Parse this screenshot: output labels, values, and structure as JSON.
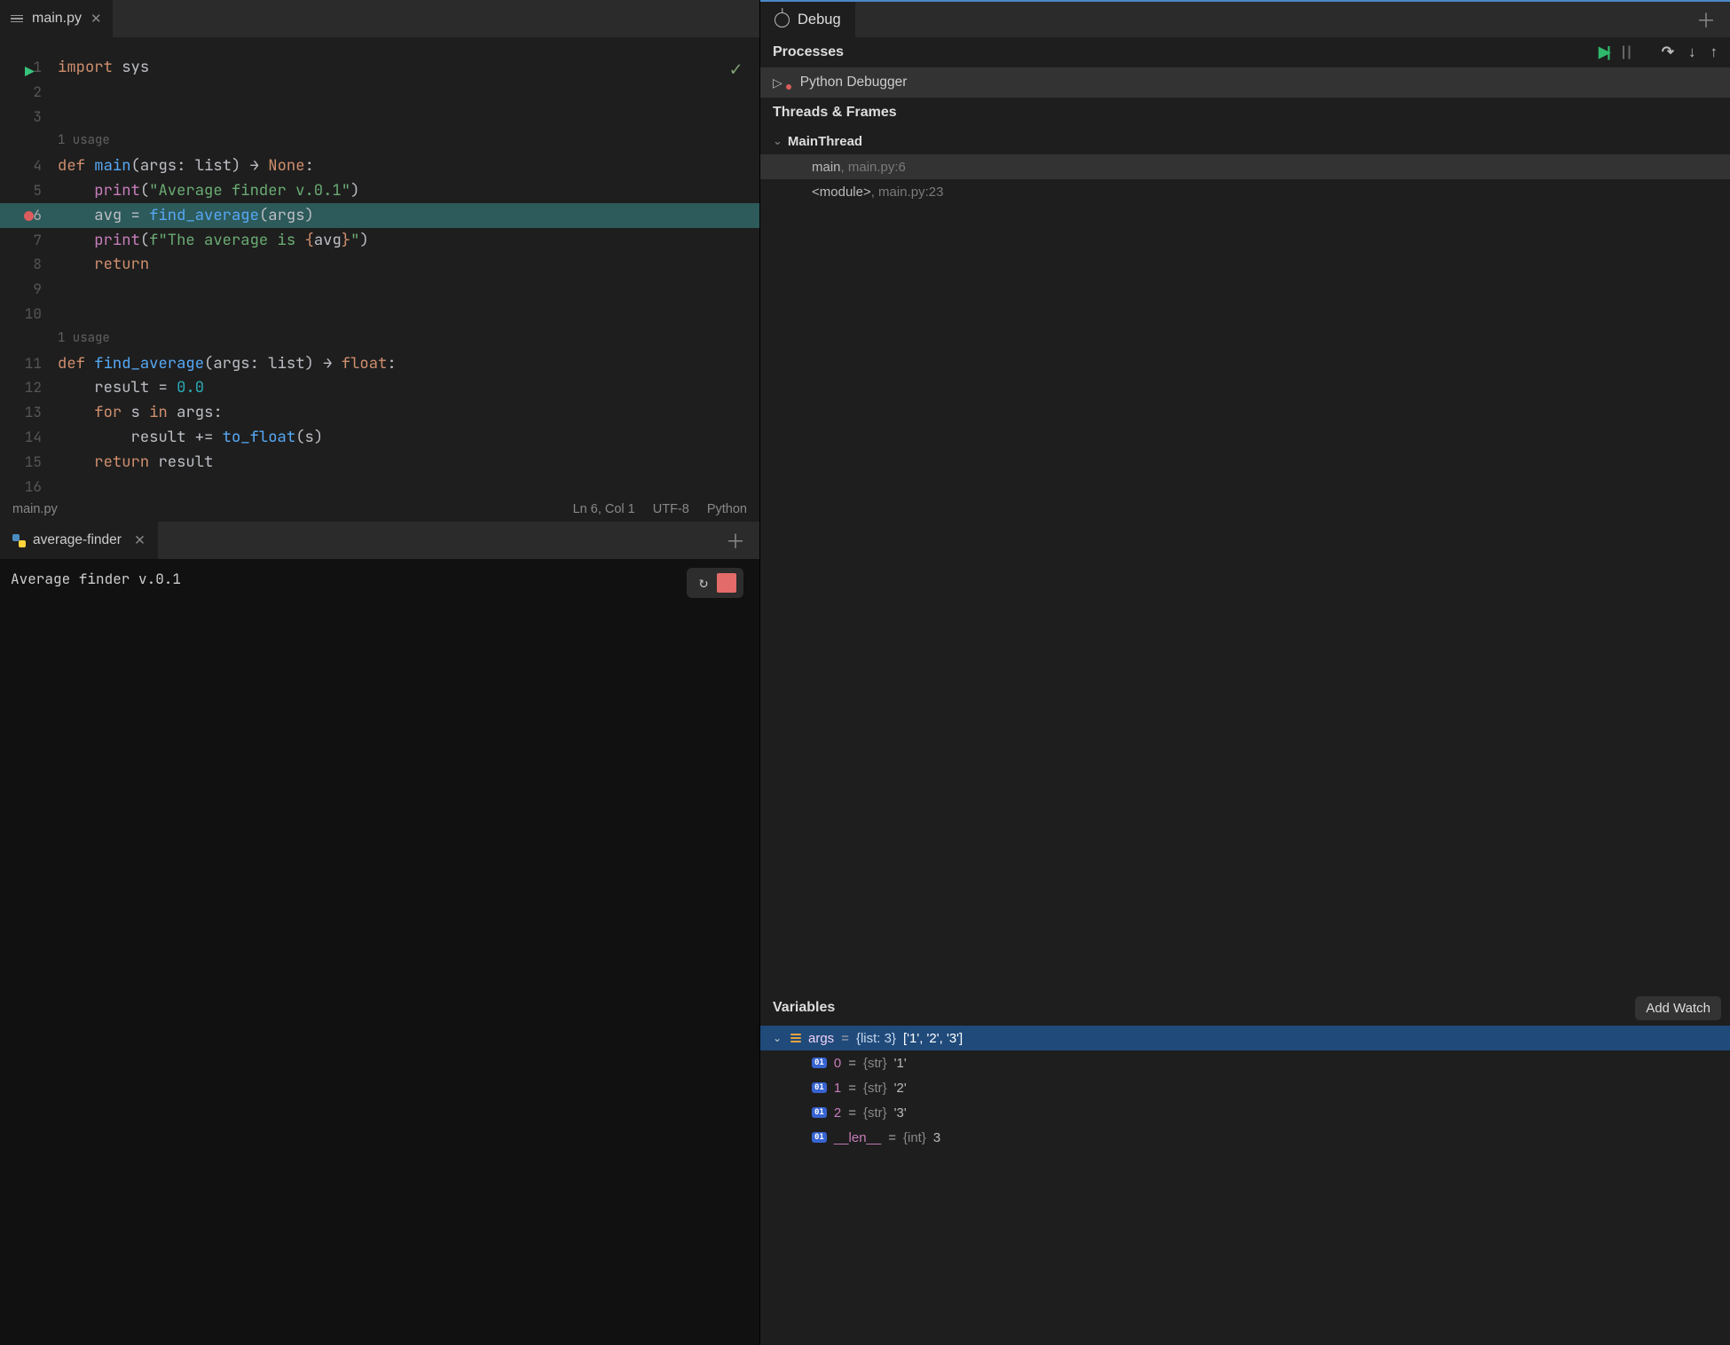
{
  "editor": {
    "tab_name": "main.py",
    "run_icon": "run-icon",
    "check_icon": "checkmark-icon",
    "usage_hint": "1 usage",
    "lines": {
      "l1": {
        "n": "1"
      },
      "l2": {
        "n": "2"
      },
      "l3": {
        "n": "3"
      },
      "l4": {
        "n": "4"
      },
      "l5": {
        "n": "5"
      },
      "l6": {
        "n": "6"
      },
      "l7": {
        "n": "7"
      },
      "l8": {
        "n": "8"
      },
      "l9": {
        "n": "9"
      },
      "l10": {
        "n": "10"
      },
      "l11": {
        "n": "11"
      },
      "l12": {
        "n": "12"
      },
      "l13": {
        "n": "13"
      },
      "l14": {
        "n": "14"
      },
      "l15": {
        "n": "15"
      },
      "l16": {
        "n": "16"
      }
    },
    "code": {
      "import": "import",
      "sys": "sys",
      "def": "def",
      "main": "main",
      "args_decl": "(args: ",
      "list": "list",
      "close_paren": ") ",
      "arrow": "→ ",
      "none": "None",
      "colon": ":",
      "print": "print",
      "str_title": "\"Average finder v.0.1\"",
      "avg": "avg",
      "eq": " = ",
      "find_avg": "find_average",
      "args_call": "(args)",
      "open_paren": "(",
      "fstr_open": "f\"The average is ",
      "brace_open": "{",
      "brace_close": "}",
      "fstr_close": "\"",
      "return": "return",
      "find_average_def": "find_average",
      "float": "float",
      "result": "result",
      "zero": "0.0",
      "for": "for",
      "s": "s",
      "in": "in",
      "args_var": "args",
      "pluseq": " += ",
      "to_float": "to_float",
      "s_call": "(s)"
    }
  },
  "status": {
    "filename": "main.py",
    "position": "Ln 6, Col 1",
    "encoding": "UTF-8",
    "language": "Python"
  },
  "console": {
    "tab_name": "average-finder",
    "output": "Average finder v.0.1"
  },
  "debug": {
    "tab_label": "Debug",
    "processes_title": "Processes",
    "process_name": "Python Debugger",
    "threads_title": "Threads & Frames",
    "thread_name": "MainThread",
    "frames": [
      {
        "fn": "main",
        "loc": ", main.py:6"
      },
      {
        "fn": "<module>",
        "loc": ", main.py:23"
      }
    ],
    "variables_title": "Variables",
    "add_watch": "Add Watch",
    "root_var": {
      "name": "args",
      "eq": " = ",
      "type": "{list: 3}",
      "val": " ['1', '2', '3']"
    },
    "children": [
      {
        "name": "0",
        "eq": " = ",
        "type": "{str}",
        "val": " '1'"
      },
      {
        "name": "1",
        "eq": " = ",
        "type": "{str}",
        "val": " '2'"
      },
      {
        "name": "2",
        "eq": " = ",
        "type": "{str}",
        "val": " '3'"
      },
      {
        "name": "__len__",
        "eq": " = ",
        "type": "{int}",
        "val": " 3"
      }
    ]
  }
}
